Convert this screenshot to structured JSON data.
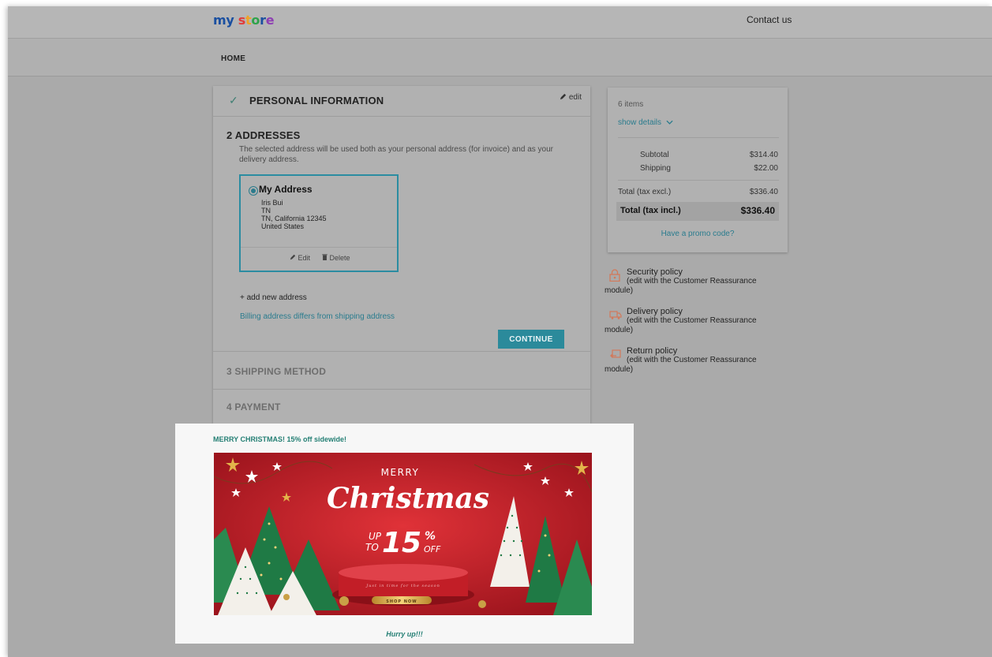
{
  "header": {
    "logo_parts": [
      {
        "text": "my",
        "color": "#1a4fa0"
      },
      {
        "text": " ",
        "color": "#000000"
      },
      {
        "text": "s",
        "color": "#e23b3b"
      },
      {
        "text": "t",
        "color": "#f0a326"
      },
      {
        "text": "o",
        "color": "#2ea34a"
      },
      {
        "text": "r",
        "color": "#1a4fa0"
      },
      {
        "text": "e",
        "color": "#8e3fb3"
      }
    ],
    "contact_label": "Contact us"
  },
  "nav": {
    "home_label": "HOME"
  },
  "checkout": {
    "step1": {
      "check_icon": "✓",
      "title": "PERSONAL INFORMATION",
      "edit_label": "edit"
    },
    "step2": {
      "title": "2  ADDRESSES",
      "description": "The selected address will be used both as your personal address (for invoice) and as your delivery address.",
      "address": {
        "alias": "My Address",
        "lines": [
          "Iris Bui",
          "TN",
          "TN, California 12345",
          "United States"
        ],
        "edit_label": "Edit",
        "delete_label": "Delete"
      },
      "add_address_label": "+ add new address",
      "billing_link": "Billing address differs from shipping address",
      "continue_label": "CONTINUE"
    },
    "step3": {
      "title": "3  SHIPPING METHOD"
    },
    "step4": {
      "title": "4  PAYMENT"
    }
  },
  "summary": {
    "items_count": "6 items",
    "show_details": "show details",
    "subtotal_label": "Subtotal",
    "subtotal_value": "$314.40",
    "shipping_label": "Shipping",
    "shipping_value": "$22.00",
    "total_excl_label": "Total (tax excl.)",
    "total_excl_value": "$336.40",
    "total_incl_label": "Total (tax incl.)",
    "total_incl_value": "$336.40",
    "promo_link": "Have a promo code?"
  },
  "reassurance": [
    {
      "title": "Security policy",
      "sub": "(edit with the Customer Reassurance",
      "tail": "module)",
      "icon": "lock-icon"
    },
    {
      "title": "Delivery policy",
      "sub": "(edit with the Customer Reassurance",
      "tail": "module)",
      "icon": "truck-icon"
    },
    {
      "title": "Return policy",
      "sub": "(edit with the Customer Reassurance",
      "tail": "module)",
      "icon": "return-icon"
    }
  ],
  "promo_banner": {
    "heading": "MERRY CHRISTMAS! 15% off sidewide!",
    "image": {
      "merry": "MERRY",
      "christmas": "Christmas",
      "up": "UP",
      "to": "TO",
      "number": "15",
      "percent": "%",
      "off": "OFF",
      "podium_text": "Just in time for the season",
      "shop_now": "SHOP NOW"
    },
    "footer": "Hurry up!!!"
  },
  "colors": {
    "accent": "#2b8a9b",
    "link": "#2a7c8e",
    "promo_green": "#247f74",
    "banner_red": "#c41f2a",
    "tree_green": "#1f7a45"
  }
}
